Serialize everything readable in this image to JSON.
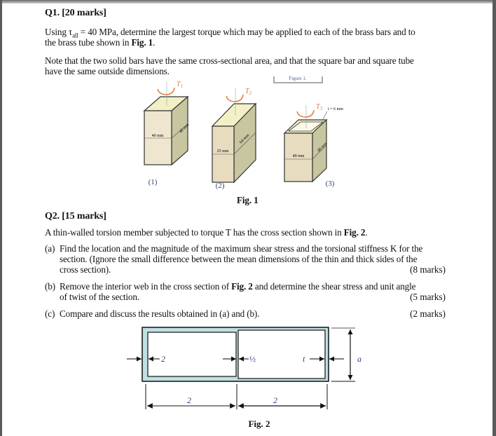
{
  "q1": {
    "heading": "Q1. [20 marks]",
    "line1_pre": "Using τ",
    "line1_sub": "all",
    "line1_post": " = 40 MPa, determine the largest torque which may be applied to each of the brass bars and to",
    "line2_pre": "the brass tube shown in ",
    "line2_bold": "Fig. 1",
    "line2_post": ".",
    "note_line1": "Note that the two solid bars have the same cross-sectional area, and that the square bar and square tube",
    "note_line2": "have the same outside dimensions.",
    "figure": {
      "caption": "Fig. 1",
      "header_fragment": "Figure 1.",
      "bars": [
        {
          "index": "(1)",
          "torque": "T1",
          "width_label": "40 mm",
          "depth_label": "40 mm"
        },
        {
          "index": "(2)",
          "torque": "T2",
          "width_label": "25 mm",
          "depth_label": "64 mm"
        },
        {
          "index": "(3)",
          "torque": "T3",
          "width_label": "40 mm",
          "depth_label": "40 mm",
          "thickness_label": "t = 6 mm"
        }
      ]
    }
  },
  "q2": {
    "heading": "Q2. [15 marks]",
    "intro_pre": "A thin-walled torsion member subjected to torque T has the cross section shown in ",
    "intro_bold": "Fig. 2",
    "intro_post": ".",
    "parts": [
      {
        "label": "(a)",
        "lines": [
          "Find the location and the magnitude of the maximum shear stress and the torsional stiffness K for the",
          "section. (Ignore the small difference between the mean dimensions of the thin and thick sides of the",
          "cross section)."
        ],
        "marks": "(8 marks)"
      },
      {
        "label": "(b)",
        "line1_pre": "Remove the interior web in the cross section of ",
        "line1_bold": "Fig. 2",
        "line1_post": " and determine the shear stress and unit angle",
        "line2": "of twist of the section.",
        "marks": "(5 marks)"
      },
      {
        "label": "(c)",
        "lines": [
          "Compare and discuss the results obtained in (a) and (b)."
        ],
        "marks": "(2 marks)"
      }
    ],
    "figure": {
      "caption": "Fig. 2",
      "dim_left_wall": "2",
      "dim_web": "½",
      "dim_right_wall": "t",
      "dim_height": "a",
      "dim_left_cell": "2",
      "dim_right_cell": "2",
      "fill_color": "#bfe0e2"
    }
  }
}
